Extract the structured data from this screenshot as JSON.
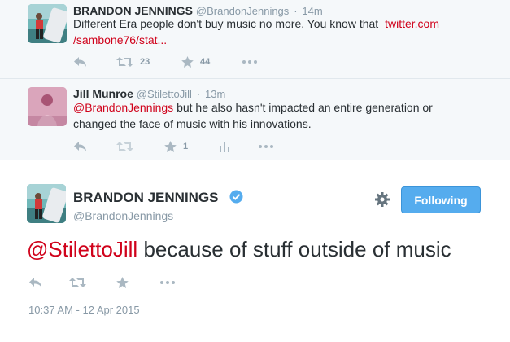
{
  "tweet1": {
    "name": "BRANDON JENNINGS",
    "handle": "@BrandonJennings",
    "dot": "·",
    "time": "14m",
    "text": "Different Era people don't buy music no more. You know that ",
    "link_line1": "twitter.com",
    "link_line2": "/sambone76/stat...",
    "retweets": "23",
    "favorites": "44"
  },
  "tweet2": {
    "name": "Jill Munroe",
    "handle": "@StilettoJill",
    "dot": "·",
    "time": "13m",
    "mention": "@BrandonJennings",
    "text": " but he also hasn't impacted an entire generation or changed the face of music with his innovations.",
    "favorites": "1"
  },
  "main": {
    "name": "BRANDON JENNINGS",
    "handle": "@BrandonJennings",
    "follow_label": "Following",
    "mention": "@StilettoJill",
    "text": " because of stuff outside of music",
    "date": "10:37 AM - 12 Apr 2015"
  },
  "colors": {
    "link": "#d0021b",
    "follow_button": "#55acee",
    "verified": "#55acee",
    "muted": "#8899a6"
  },
  "icons": [
    "reply-icon",
    "retweet-icon",
    "favorite-icon",
    "analytics-icon",
    "more-icon",
    "gear-icon",
    "verified-icon"
  ]
}
